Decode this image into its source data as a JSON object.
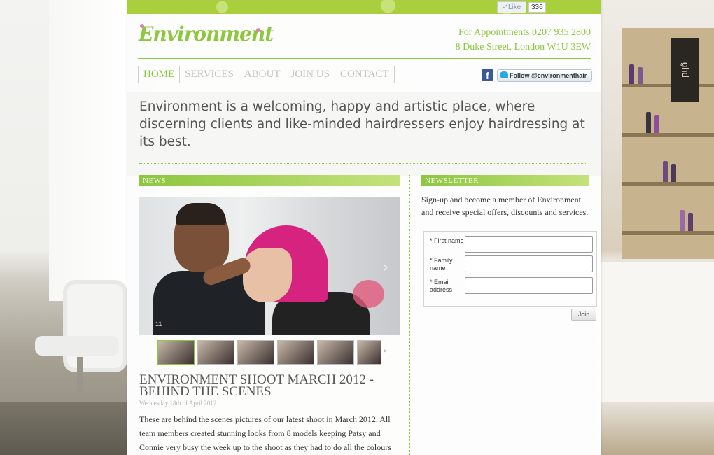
{
  "social": {
    "like_label": "✓Like",
    "like_count": "336",
    "facebook_glyph": "f",
    "twitter_label": "Follow @environmenthair"
  },
  "header": {
    "logo_text": "Environment",
    "appointments": "For Appointments 0207 935 2800",
    "address": "8 Duke Street, London W1U 3EW"
  },
  "nav": {
    "items": [
      "HOME",
      "SERVICES",
      "ABOUT",
      "JOIN US",
      "CONTACT"
    ],
    "active": "HOME"
  },
  "intro": "Environment is a welcoming, happy and artistic place, where discerning clients and like-minded hairdressers enjoy hairdressing at its best.",
  "news": {
    "heading": "NEWS",
    "slide_number": "11",
    "next_glyph": "›",
    "thumb_next_glyph": "▸",
    "title": "ENVIRONMENT SHOOT MARCH 2012 - BEHIND THE SCENES",
    "date": "Wednesday 18th of April 2012",
    "body": "These are behind the scenes pictures of our latest shoot in March 2012. All team members created stunning looks from 8 models keeping Patsy and Connie very busy the week up to the shoot as they had to do all the colours"
  },
  "newsletter": {
    "heading": "NEWSLETTER",
    "intro": "Sign-up and become a member of Environment and receive special offers, discounts and services.",
    "fields": [
      {
        "label": "* First name",
        "value": ""
      },
      {
        "label": "* Family name",
        "value": ""
      },
      {
        "label": "* Email address",
        "value": ""
      }
    ],
    "submit_label": "Join"
  },
  "colors": {
    "accent": "#8dc63f",
    "topbar": "#a9cf3c",
    "facebook": "#3b5998",
    "twitter": "#2aa9e0"
  },
  "backdrop": {
    "shelf_brand": "ghd"
  }
}
